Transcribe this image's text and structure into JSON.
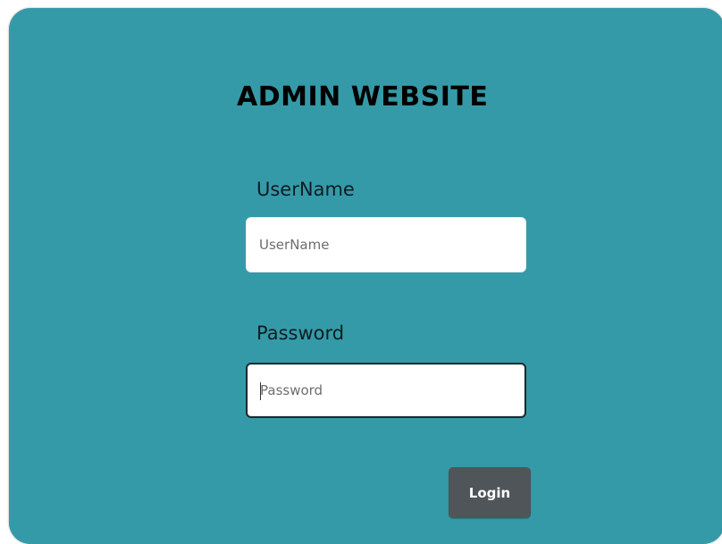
{
  "page": {
    "title": "ADMIN WEBSITE"
  },
  "form": {
    "username": {
      "label": "UserName",
      "placeholder": "UserName",
      "value": ""
    },
    "password": {
      "label": "Password",
      "placeholder": "Password",
      "value": ""
    },
    "login_label": "Login"
  },
  "colors": {
    "panel_background": "#359aa8",
    "button_background": "#4f5558",
    "button_text": "#ffffff"
  }
}
